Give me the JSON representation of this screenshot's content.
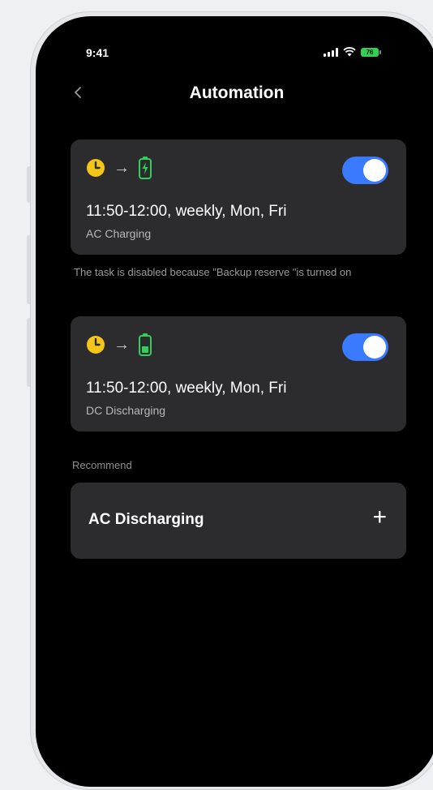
{
  "status_bar": {
    "time": "9:41",
    "battery_level": "76"
  },
  "header": {
    "title": "Automation"
  },
  "tasks": [
    {
      "schedule": "11:50-12:00, weekly, Mon, Fri",
      "mode": "AC Charging",
      "enabled": true,
      "trigger_icon": "clock-icon",
      "action_icon": "battery-charging-icon"
    },
    {
      "schedule": "11:50-12:00, weekly, Mon, Fri",
      "mode": "DC Discharging",
      "enabled": true,
      "trigger_icon": "clock-icon",
      "action_icon": "battery-discharging-icon"
    }
  ],
  "notice": "The task is disabled because \"Backup reserve \"is turned on",
  "recommend": {
    "section_label": "Recommend",
    "items": [
      {
        "label": "AC Discharging",
        "action_icon": "plus-icon"
      }
    ]
  },
  "colors": {
    "accent_toggle": "#3a7afe",
    "clock_yellow": "#f5c518",
    "battery_green": "#30d158",
    "card_bg": "#2c2c2e"
  }
}
